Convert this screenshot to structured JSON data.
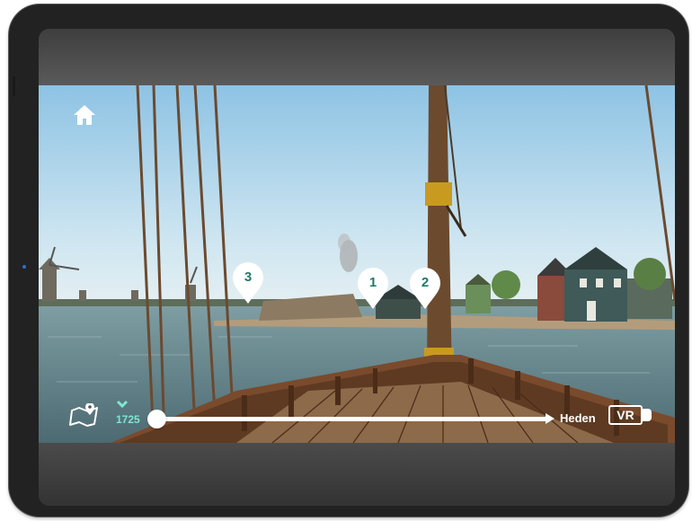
{
  "app": {
    "home_icon": "home-icon",
    "map_icon": "map-pin-icon",
    "vr_icon": "vr-headset-icon"
  },
  "hotspots": [
    {
      "label": "3"
    },
    {
      "label": "1"
    },
    {
      "label": "2"
    }
  ],
  "timeline": {
    "start_year": "1725",
    "end_label": "Heden",
    "position": 0.0
  },
  "vr": {
    "label": "VR"
  },
  "colors": {
    "accent": "#7fe6d2",
    "marker_text": "#1f7a68",
    "sky": "#bfe0f0",
    "water": "#6e8e96"
  }
}
